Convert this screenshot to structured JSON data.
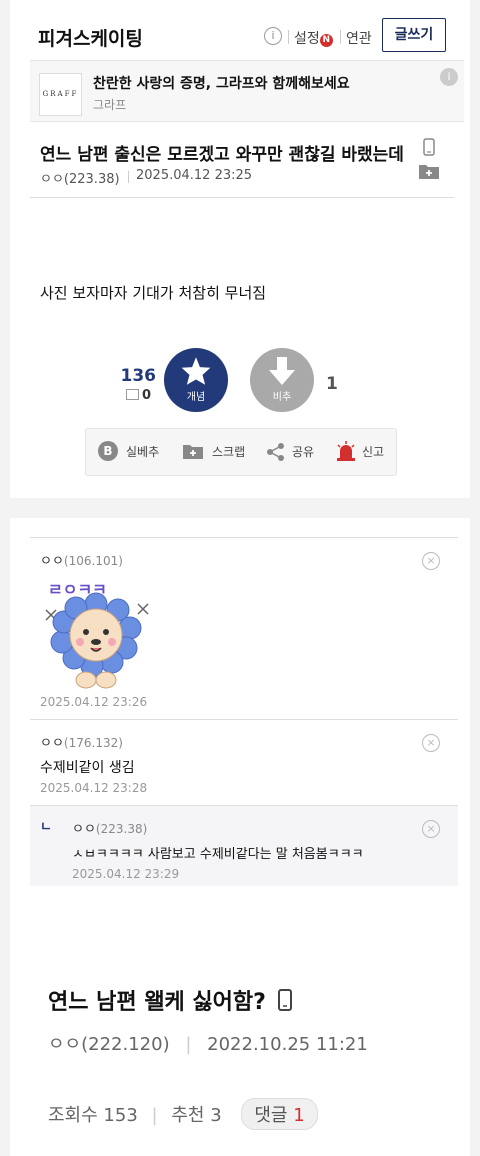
{
  "header": {
    "gallery_title": "피겨스케이팅",
    "info_icon": "i",
    "settings_label": "설정",
    "n_badge": "N",
    "related_label": "연관",
    "write_label": "글쓰기"
  },
  "ad": {
    "logo_text": "GRAFF",
    "title": "찬란한 사랑의 증명, 그라프와 함께해보세요",
    "sponsor": "그라프",
    "info_icon": "i"
  },
  "post": {
    "title": "연느 남편 출신은 모르겠고 와꾸만 괜찮길 바랬는데",
    "author": "ㅇㅇ",
    "ip": "(223.38)",
    "date": "2025.04.12 23:25",
    "body": "사진 보자마자 기대가 처참히 무너짐",
    "upvotes": "136",
    "upvote_fixed": "0",
    "upvote_label": "개념",
    "downvote_label": "비추",
    "downvotes": "1"
  },
  "actions": {
    "real_best": "실베추",
    "scrap": "스크랩",
    "share": "공유",
    "report": "신고"
  },
  "comments": [
    {
      "author": "ㅇㅇ",
      "ip": "(106.101)",
      "sticker_text": "ㄹㅇㅋㅋ",
      "date": "2025.04.12 23:26"
    },
    {
      "author": "ㅇㅇ",
      "ip": "(176.132)",
      "text": "수제비같이 생김",
      "date": "2025.04.12 23:28"
    },
    {
      "author": "ㅇㅇ",
      "ip": "(223.38)",
      "text": "ㅅㅂㅋㅋㅋㅋ 사람보고 수제비같다는 말 처음봄ㅋㅋㅋ",
      "date": "2025.04.12 23:29",
      "reply_mark": "ㄴ"
    }
  ],
  "next_post": {
    "title": "연느 남편 왤케 싫어함?",
    "author": "ㅇㅇ",
    "ip": "(222.120)",
    "date": "2022.10.25 11:21",
    "views_label": "조회수",
    "views": "153",
    "recommend_label": "추천",
    "recommend": "3",
    "comments_label": "댓글",
    "comments": "1"
  },
  "icons": [
    "info-icon",
    "phone-icon",
    "folder-plus-icon",
    "star-icon",
    "arrow-down-icon",
    "b-icon",
    "plus-icon",
    "share-icon",
    "siren-icon",
    "close-icon",
    "lion-sticker"
  ],
  "colors": {
    "brand_navy": "#1a2c5b",
    "upvote": "#233a7a",
    "downvote": "#a9a9a9",
    "red": "#d32f2f"
  }
}
